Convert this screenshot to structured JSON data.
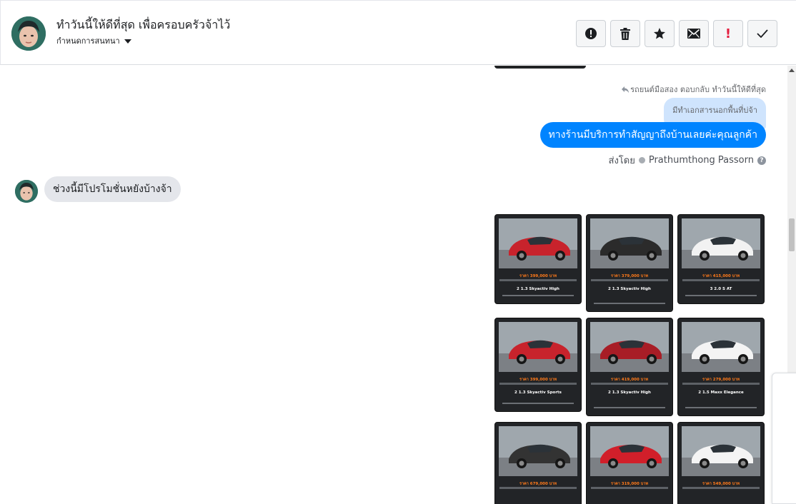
{
  "header": {
    "title": "ทำวันนี้ให้ดีที่สุด เพื่อครอบครัวจ้าไว้",
    "subtitle": "กำหนดการสนทนา"
  },
  "toolbar": {
    "buttons": [
      {
        "icon": "alert-circle-icon"
      },
      {
        "icon": "trash-icon"
      },
      {
        "icon": "star-icon"
      },
      {
        "icon": "envelope-icon"
      },
      {
        "icon": "exclamation-icon",
        "label": "!"
      },
      {
        "icon": "check-icon"
      }
    ]
  },
  "messages": {
    "reply_meta": "รถยนต์มือสอง ตอบกลับ ทำวันนี้ให้ดีที่สุด",
    "quoted_text": "มีทำเอกสารนอกพื้นที่บ่จ้า",
    "outgoing_text": "ทางร้านมีบริการทำสัญญาถึงบ้านเลยค่ะคุณลูกค้า",
    "sent_by_prefix": "ส่งโดย",
    "sent_by_name": "Prathumthong Passorn",
    "incoming_text": "ช่วงนี้มีโปรโมชั่นหยังบ้างจ้า"
  },
  "cars": [
    {
      "price": "ราคา 399,000 บาท",
      "model": "2 1.3 Skyactiv High",
      "color": "#c8232c"
    },
    {
      "price": "ราคา 379,000 บาท",
      "model": "2 1.3 Skyactiv High",
      "color": "#2b2b2b"
    },
    {
      "price": "ราคา 415,000 บาท",
      "model": "3 2.0 S AT",
      "color": "#f2f2f2"
    },
    {
      "price": "ราคา 399,000 บาท",
      "model": "2 1.3 Skyactiv Sports",
      "color": "#c8232c"
    },
    {
      "price": "ราคา 419,000 บาท",
      "model": "2 1.3 Skyactiv High",
      "color": "#a81d26"
    },
    {
      "price": "ราคา 279,000 บาท",
      "model": "2 1.5 Maxx Elegance",
      "color": "#f4f4f4"
    },
    {
      "price": "ราคา 679,000 บาท",
      "model": "",
      "color": "#333333"
    },
    {
      "price": "ราคา 319,000 บาท",
      "model": "",
      "color": "#d11f2a"
    },
    {
      "price": "ราคา 549,000 บาท",
      "model": "",
      "color": "#f4f4f4"
    }
  ]
}
